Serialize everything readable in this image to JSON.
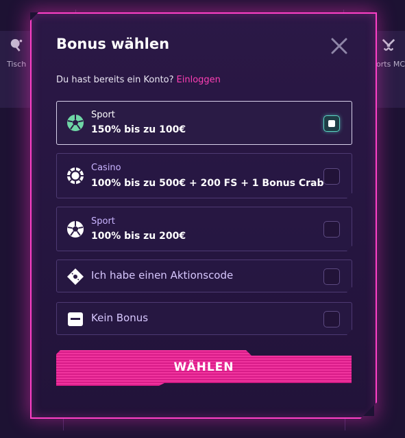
{
  "background": {
    "left_label": "Tisch",
    "right_label": "ports MC"
  },
  "modal": {
    "title": "Bonus wählen",
    "login_prompt": "Du hast bereits ein Konto?",
    "login_link": "Einloggen",
    "close_icon": "close-icon",
    "options": [
      {
        "label": "Sport",
        "title": "150% bis zu 100€",
        "icon": "soccer-ball-icon",
        "selected": true
      },
      {
        "label": "Casino",
        "title": "100% bis zu 500€ + 200 FS + 1 Bonus Crab",
        "icon": "casino-chip-icon",
        "selected": false
      },
      {
        "label": "Sport",
        "title": "100% bis zu 200€",
        "icon": "soccer-ball-icon",
        "selected": false
      },
      {
        "text": "Ich habe einen Aktionscode",
        "icon": "ticket-icon",
        "selected": false
      },
      {
        "text": "Kein Bonus",
        "icon": "no-bonus-icon",
        "selected": false
      }
    ],
    "submit_label": "WÄHLEN"
  },
  "colors": {
    "accent": "#ff40c8",
    "link": "#ff3fb5",
    "selected_check": "#5ad6c4",
    "background": "#1d1233"
  }
}
